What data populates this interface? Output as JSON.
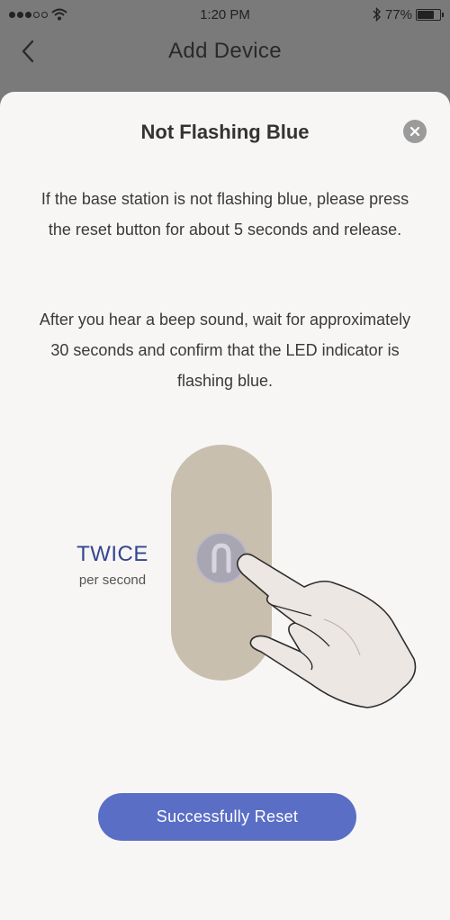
{
  "status_bar": {
    "time": "1:20 PM",
    "battery_percent": "77%",
    "battery_level": 0.77,
    "signal_bars_filled": 3,
    "signal_bars_total": 5
  },
  "nav": {
    "title": "Add Device",
    "back_icon": "chevron-left-icon"
  },
  "sheet": {
    "title": "Not Flashing Blue",
    "close_icon": "close-icon",
    "instruction_1": "If the base station is not flashing blue, please press the reset button for about 5 seconds and release.",
    "instruction_2": "After you hear a beep sound, wait for approximately 30 seconds and confirm that the LED indicator is flashing blue.",
    "frequency_label": "TWICE",
    "frequency_sub": "per second",
    "primary_button": "Successfully Reset"
  },
  "colors": {
    "accent": "#5a6ec6",
    "frequency_text": "#34468f",
    "device_body": "#c8bfae",
    "sheet_bg": "#f7f6f4"
  }
}
